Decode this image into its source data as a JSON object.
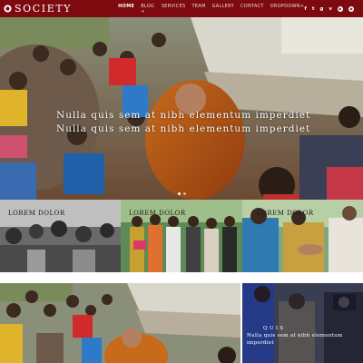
{
  "brand": {
    "name": "SOCIETY",
    "color": "#7d0a0f"
  },
  "nav": {
    "items": [
      {
        "label": "HOME"
      },
      {
        "label": "BLOG +"
      },
      {
        "label": "SERVICES"
      },
      {
        "label": "TEAM"
      },
      {
        "label": "GALLERY"
      },
      {
        "label": "CONTACT"
      },
      {
        "label": "DROPDOWN+"
      }
    ],
    "social_icons": [
      "facebook-icon",
      "twitter-icon",
      "google-plus-icon",
      "vimeo-icon",
      "youtube-icon",
      "instagram-icon"
    ]
  },
  "hero": {
    "caption_line1": "Nulla quis sem at nibh elementum imperdiet",
    "caption_line2": "Nulla quis sem at nibh elementum imperdiet"
  },
  "gallery": {
    "tile1_label": "LOREM DOLOR",
    "tile2_label": "LOREM DOLOR",
    "tile3_label": "LOREM DOLOR",
    "mini_caption_title": "Q U I S",
    "mini_caption_text": "Nulla quis sem at nibh elementum imperdiet"
  }
}
